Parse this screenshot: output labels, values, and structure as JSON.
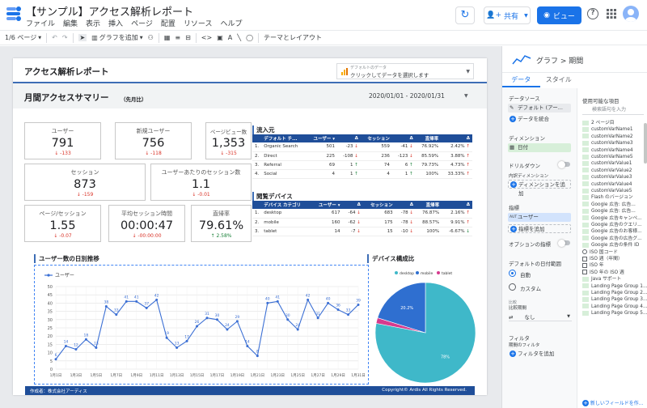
{
  "app": {
    "title": "【サンプル】アクセス解析レポート",
    "menu": [
      "ファイル",
      "編集",
      "表示",
      "挿入",
      "ページ",
      "配置",
      "リソース",
      "ヘルプ"
    ],
    "share_label": "共有",
    "view_label": "ビュー"
  },
  "toolbar": {
    "page_indicator": "1/6 ページ",
    "add_chart": "グラフを追加",
    "theme_layout": "テーマとレイアウト"
  },
  "report": {
    "title": "アクセス解析レポート",
    "datasource": {
      "label": "デフォルトのデータ",
      "prompt": "クリックしてデータを選択します"
    },
    "summary_title": "月間アクセスサマリー",
    "summary_sub": "（先月比）",
    "date_range": "2020/01/01 - 2020/01/31",
    "footer_left": "作成者：株式会社アーディス",
    "footer_right": "Copyright© Ardis All Rights Reserved."
  },
  "kpis": [
    {
      "label": "ユーザー",
      "value": "791",
      "delta": "-133"
    },
    {
      "label": "新規ユーザー",
      "value": "756",
      "delta": "-118"
    },
    {
      "label": "ページビュー数",
      "value": "1,353",
      "delta": "-315"
    },
    {
      "label": "セッション",
      "value": "873",
      "delta": "-159"
    },
    {
      "label": "ユーザーあたりのセッション数",
      "value": "1.1",
      "delta": "-0.01"
    },
    {
      "label": "ページ/セッション",
      "value": "1.55",
      "delta": "-0.07"
    },
    {
      "label": "平均セッション時間",
      "value": "00:00:47",
      "delta": "-00:00:00"
    },
    {
      "label": "直帰率",
      "value": "79.61%",
      "delta": "2.58%"
    }
  ],
  "channels": {
    "title": "流入元",
    "headers": [
      "デフォルト チ...",
      "ユーザー ▾",
      "Δ",
      "セッション",
      "Δ",
      "直帰率",
      "Δ"
    ],
    "rows": [
      [
        "1.",
        "Organic Search",
        "501",
        "-23",
        "559",
        "-41",
        "76.92%",
        "2.42%"
      ],
      [
        "2.",
        "Direct",
        "225",
        "-108",
        "236",
        "-123",
        "85.59%",
        "3.88%"
      ],
      [
        "3.",
        "Referral",
        "69",
        "1",
        "74",
        "6",
        "79.73%",
        "4.73%"
      ],
      [
        "4.",
        "Social",
        "4",
        "1",
        "4",
        "1",
        "100%",
        "33.33%"
      ]
    ]
  },
  "devices": {
    "title": "閲覧デバイス",
    "headers": [
      "デバイス カテゴリ",
      "ユーザー ▾",
      "Δ",
      "セッション",
      "Δ",
      "直帰率",
      "Δ"
    ],
    "rows": [
      [
        "1.",
        "desktop",
        "617",
        "-64",
        "683",
        "-78",
        "76.87%",
        "2.16%"
      ],
      [
        "2.",
        "mobile",
        "160",
        "-62",
        "175",
        "-78",
        "88.57%",
        "9.91%"
      ],
      [
        "3.",
        "tablet",
        "14",
        "-7",
        "15",
        "-10",
        "100%",
        "-6.67%"
      ]
    ]
  },
  "chart_data": [
    {
      "type": "line",
      "title": "ユーザー数の日別推移",
      "legend": "top-left",
      "series": [
        {
          "name": "ユーザー",
          "values": [
            6,
            14,
            12,
            18,
            13,
            38,
            33,
            41,
            41,
            37,
            42,
            19,
            13,
            17,
            26,
            31,
            30,
            24,
            29,
            14,
            8,
            40,
            41,
            30,
            24,
            42,
            31,
            40,
            36,
            33,
            39
          ]
        }
      ],
      "x": [
        "1月1日",
        "1月2日",
        "1月3日",
        "1月4日",
        "1月5日",
        "1月6日",
        "1月7日",
        "1月8日",
        "1月9日",
        "1月10日",
        "1月11日",
        "1月12日",
        "1月13日",
        "1月14日",
        "1月15日",
        "1月16日",
        "1月17日",
        "1月18日",
        "1月19日",
        "1月20日",
        "1月21日",
        "1月22日",
        "1月23日",
        "1月24日",
        "1月25日",
        "1月26日",
        "1月27日",
        "1月28日",
        "1月29日",
        "1月30日",
        "1月31日"
      ],
      "x_ticks": [
        "1月1日",
        "1月3日",
        "1月5日",
        "1月7日",
        "1月9日",
        "1月11日",
        "1月13日",
        "1月15日",
        "1月17日",
        "1月19日",
        "1月21日",
        "1月23日",
        "1月25日",
        "1月27日",
        "1月29日",
        "1月31日"
      ],
      "yticks": [
        "0",
        "5",
        "10",
        "15",
        "20",
        "25",
        "30",
        "35",
        "40",
        "45",
        "50"
      ],
      "ylim": [
        0,
        50
      ],
      "grid": true,
      "color": "#3b6fd4"
    },
    {
      "type": "pie",
      "title": "デバイス構成比",
      "legend": "top",
      "slices": [
        {
          "label": "desktop",
          "value": 78,
          "display": "78%",
          "color": "#3fb8c9"
        },
        {
          "label": "mobile",
          "value": 20.2,
          "display": "20.2%",
          "color": "#2f6fd0"
        },
        {
          "label": "tablet",
          "value": 1.8,
          "display": "",
          "color": "#d63a8e"
        }
      ]
    }
  ],
  "panel": {
    "breadcrumb": "グラフ > 期間",
    "tabs": [
      "データ",
      "スタイル"
    ],
    "datasource_label": "データソース",
    "datasource_value": "デフォルト (アー...",
    "blend": "データを統合",
    "dimension_label": "ディメンション",
    "dimension_value": "日付",
    "drilldown": "ドリルダウン",
    "date_dim": "内訳ディメンション",
    "add_dimension": "ディメンションを追加",
    "metric_label": "指標",
    "metric_value": "ユーザー",
    "add_metric": "指標を追加",
    "optional_metrics": "オプションの指標",
    "date_range_label": "デフォルトの日付範囲",
    "auto": "自動",
    "custom": "カスタム",
    "compare_label1": "比較",
    "compare_label2": "比較期間",
    "compare_value": "なし",
    "filter_label": "フィルタ",
    "period_filter": "期間のフィルタ",
    "add_filter": "フィルタを追加",
    "fields_header": "使用可能な項目",
    "search_placeholder": "検索語句を入力",
    "fields": [
      "2 ページ目",
      "customVarName1",
      "customVarName2",
      "customVarName3",
      "customVarName4",
      "customVarName5",
      "customVarValue1",
      "customVarValue2",
      "customVarValue3",
      "customVarValue4",
      "customVarValue5",
      "Flash のバージョン",
      "Google 広告: 広告...",
      "Google 広告: 広告...",
      "Google 広告キャンペ...",
      "Google 広告のクエリ...",
      "Google 広告のお客様...",
      "Google 広告の広告グ...",
      "Google 広告の条件 ID",
      "ISO 国コード",
      "ISO 週（年間）",
      "ISO 年",
      "ISO 年の ISO 週",
      "Java サポート",
      "Landing Page Group 1...",
      "Landing Page Group 2...",
      "Landing Page Group 3...",
      "Landing Page Group 4...",
      "Landing Page Group 5..."
    ],
    "new_field": "新しいフィールドを作..."
  }
}
